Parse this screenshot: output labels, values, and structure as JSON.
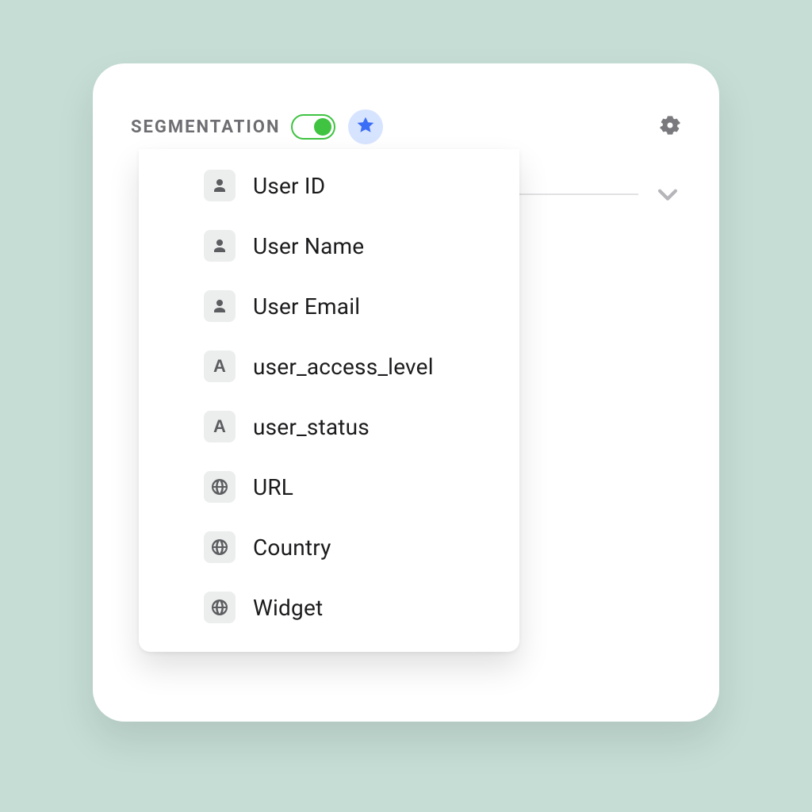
{
  "header": {
    "title": "SEGMENTATION",
    "toggle_on": true
  },
  "dropdown": {
    "items": [
      {
        "icon": "person",
        "label": "User ID"
      },
      {
        "icon": "person",
        "label": "User Name"
      },
      {
        "icon": "person",
        "label": "User Email"
      },
      {
        "icon": "letter-A",
        "label": "user_access_level"
      },
      {
        "icon": "letter-A",
        "label": "user_status"
      },
      {
        "icon": "globe",
        "label": "URL"
      },
      {
        "icon": "globe",
        "label": "Country"
      },
      {
        "icon": "globe",
        "label": "Widget"
      }
    ]
  }
}
